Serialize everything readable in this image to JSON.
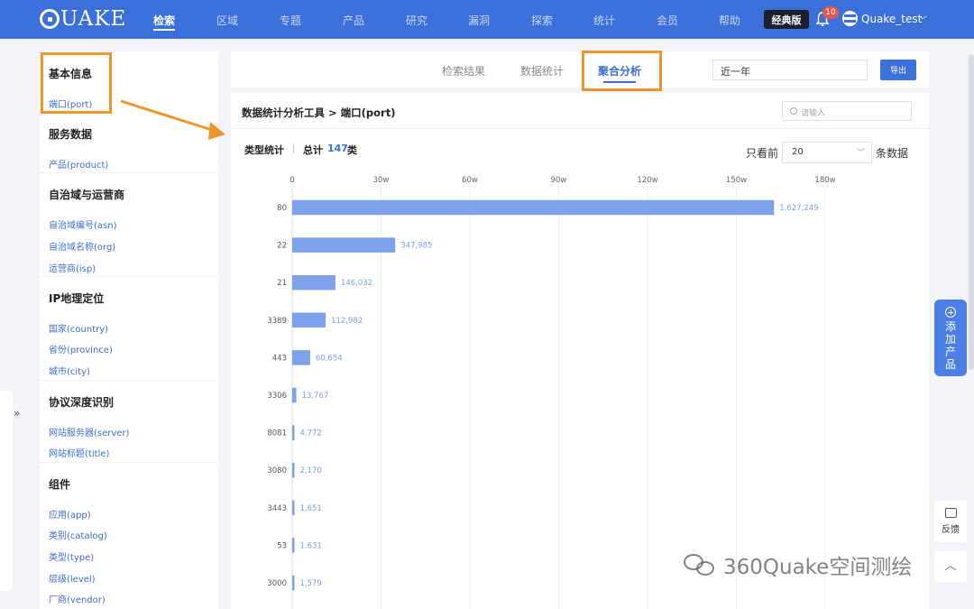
{
  "brand": {
    "logo_text": "UAKE"
  },
  "nav": {
    "items": [
      {
        "label": "检索",
        "active": true
      },
      {
        "label": "区域"
      },
      {
        "label": "专题"
      },
      {
        "label": "产品"
      },
      {
        "label": "研究"
      },
      {
        "label": "漏洞"
      },
      {
        "label": "探索"
      },
      {
        "label": "统计"
      },
      {
        "label": "会员"
      },
      {
        "label": "帮助"
      }
    ],
    "classic_label": "经典版",
    "notification_count": "10",
    "username": "Quake_test"
  },
  "sidebar": {
    "groups": [
      {
        "title": "基本信息",
        "items": [
          "端口(port)"
        ]
      },
      {
        "title": "服务数据",
        "items": [
          "产品(product)"
        ]
      },
      {
        "title": "自治域与运营商",
        "items": [
          "自治域编号(asn)",
          "自治域名称(org)",
          "运营商(isp)"
        ]
      },
      {
        "title": "IP地理定位",
        "items": [
          "国家(country)",
          "省份(province)",
          "城市(city)"
        ]
      },
      {
        "title": "协议深度识别",
        "items": [
          "网站服务器(server)",
          "网站标题(title)"
        ]
      },
      {
        "title": "组件",
        "items": [
          "应用(app)",
          "类别(catalog)",
          "类型(type)",
          "层级(level)",
          "厂商(vendor)"
        ]
      }
    ]
  },
  "tabs": [
    {
      "label": "检索结果"
    },
    {
      "label": "数据统计"
    },
    {
      "label": "聚合分析",
      "active": true
    }
  ],
  "time_range": "近一年",
  "export_label": "导出",
  "main": {
    "title": "数据统计分析工具 > 端口(port)",
    "search_placeholder": "请输入",
    "type_stat_label": "类型统计",
    "total_label": "总计",
    "total_count": "147",
    "total_unit": "类",
    "only_see_label": "只看前",
    "only_see_value": "20",
    "rows_label": "条数据"
  },
  "chart_data": {
    "type": "bar",
    "orientation": "horizontal",
    "categories": [
      "80",
      "22",
      "21",
      "3389",
      "443",
      "3306",
      "8081",
      "3080",
      "3443",
      "53",
      "3000"
    ],
    "values": [
      1627249,
      347985,
      146032,
      112982,
      60654,
      13767,
      4772,
      2170,
      1651,
      1631,
      1579
    ],
    "value_labels": [
      "1,627,249",
      "347,985",
      "146,032",
      "112,982",
      "60,654",
      "13,767",
      "4,772",
      "2,170",
      "1,651",
      "1,631",
      "1,579"
    ],
    "x_ticks": [
      "0",
      "30w",
      "60w",
      "90w",
      "120w",
      "150w",
      "180w"
    ],
    "xlim": [
      0,
      1800000
    ],
    "grid": true,
    "bar_color": "#7da2ea"
  },
  "float": {
    "add_product_label": "添加产品",
    "feedback_label": "反馈",
    "to_top_icon": "chevron-up-icon"
  },
  "watermark": "360Quake空间测绘",
  "colors": {
    "primary": "#3b6fd9",
    "highlight": "#f0942c"
  }
}
